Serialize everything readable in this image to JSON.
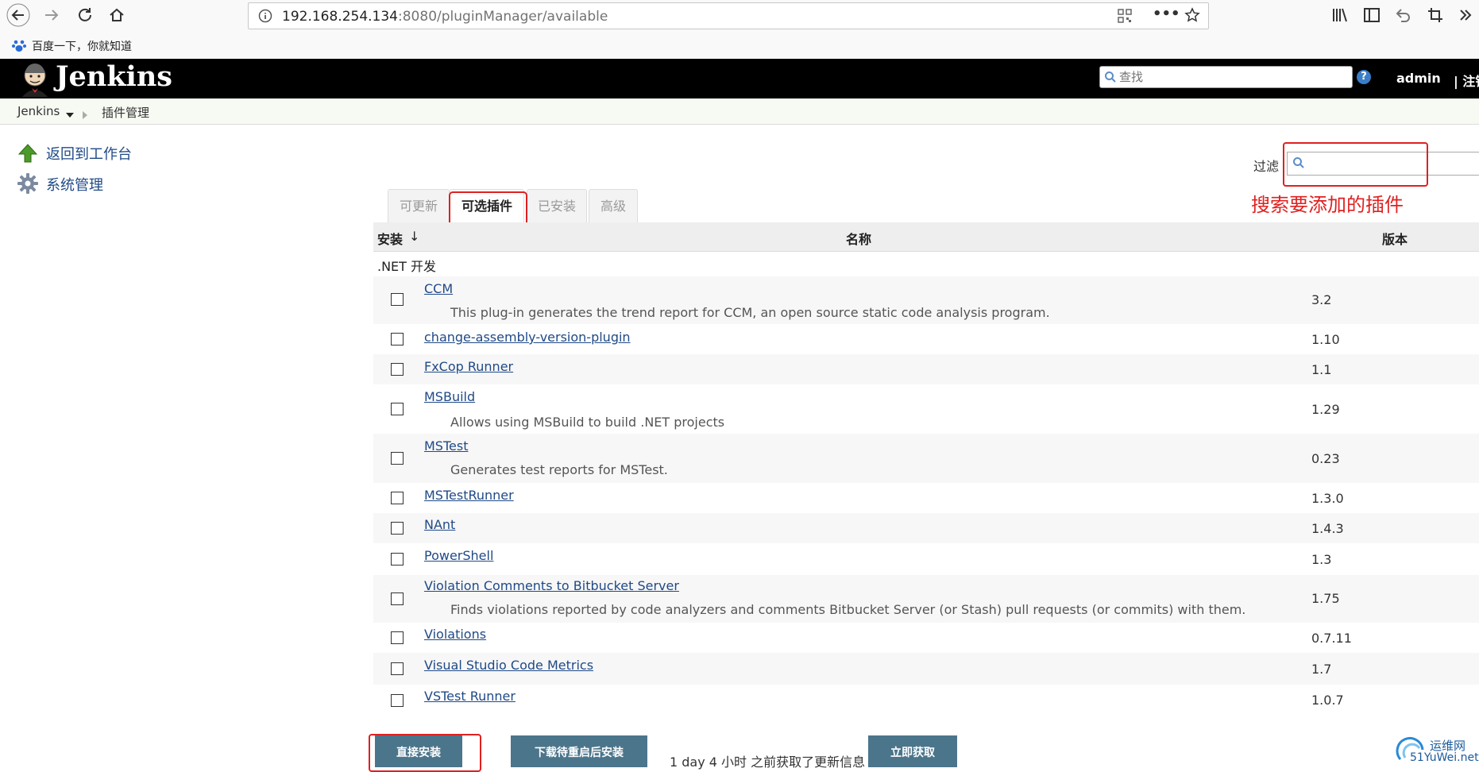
{
  "browser": {
    "url_host": "192.168.254.134",
    "url_path": ":8080/pluginManager/available",
    "bookmark": "百度一下，你就知道"
  },
  "header": {
    "logo": "Jenkins",
    "search_placeholder": "查找",
    "help": "?",
    "user": "admin",
    "logout": "| 注销"
  },
  "breadcrumb": {
    "root": "Jenkins",
    "current": "插件管理"
  },
  "sidebar": {
    "items": [
      {
        "label": "返回到工作台",
        "icon": "up-arrow-icon"
      },
      {
        "label": "系统管理",
        "icon": "gear-icon"
      }
    ]
  },
  "filter": {
    "label": "过滤",
    "annotation": "搜索要添加的插件"
  },
  "tabs": [
    {
      "label": "可更新"
    },
    {
      "label": "可选插件",
      "active": true
    },
    {
      "label": "已安装"
    },
    {
      "label": "高级"
    }
  ],
  "table": {
    "col_install": "安装",
    "sort_arrow": "↓",
    "col_name": "名称",
    "col_version": "版本",
    "category": ".NET 开发",
    "rows": [
      {
        "name": "CCM",
        "desc": "This plug-in generates the trend report for CCM, an open source static code analysis program.",
        "version": "3.2"
      },
      {
        "name": "change-assembly-version-plugin",
        "desc": "",
        "version": "1.10"
      },
      {
        "name": "FxCop Runner",
        "desc": "",
        "version": "1.1"
      },
      {
        "name": "MSBuild",
        "desc": "Allows using MSBuild to build .NET projects",
        "version": "1.29"
      },
      {
        "name": "MSTest",
        "desc": "Generates test reports for MSTest.",
        "version": "0.23"
      },
      {
        "name": "MSTestRunner",
        "desc": "",
        "version": "1.3.0"
      },
      {
        "name": "NAnt",
        "desc": "",
        "version": "1.4.3"
      },
      {
        "name": "PowerShell",
        "desc": "",
        "version": "1.3"
      },
      {
        "name": "Violation Comments to Bitbucket Server",
        "desc": "Finds violations reported by code analyzers and comments Bitbucket Server (or Stash) pull requests (or commits) with them.",
        "version": "1.75"
      },
      {
        "name": "Violations",
        "desc": "",
        "version": "0.7.11"
      },
      {
        "name": "Visual Studio Code Metrics",
        "desc": "",
        "version": "1.7"
      },
      {
        "name": "VSTest Runner",
        "desc": "",
        "version": "1.0.7"
      }
    ]
  },
  "bottom": {
    "install_now": "直接安装",
    "install_after_restart": "下载待重启后安装",
    "update_info": "1 day 4 小时 之前获取了更新信息",
    "check_now": "立即获取"
  },
  "watermark": {
    "title": "运维网",
    "sub": "51YuWei.net"
  }
}
